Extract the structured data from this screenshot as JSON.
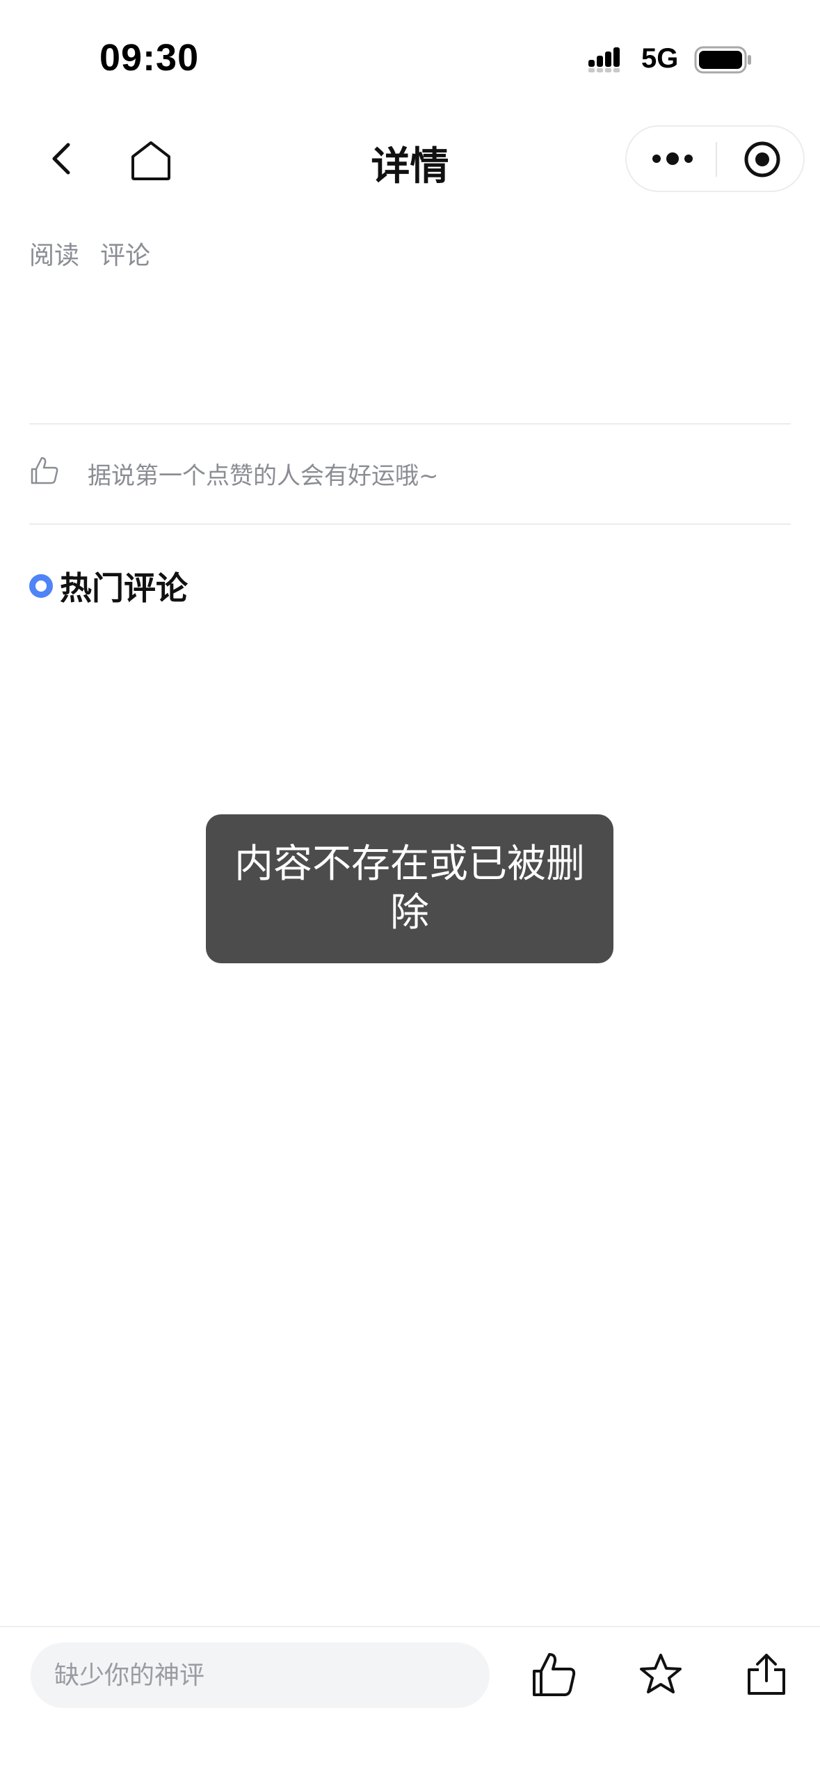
{
  "status_bar": {
    "time": "09:30",
    "network": "5G"
  },
  "nav": {
    "title": "详情",
    "icons": {
      "back": "chevron-left-icon",
      "home": "home-icon",
      "more": "more-dots-icon",
      "close": "target-circle-icon"
    }
  },
  "meta": {
    "read_label": "阅读",
    "comment_label": "评论"
  },
  "like_hint": "据说第一个点赞的人会有好运哦~",
  "hot_comments": {
    "title": "热门评论",
    "accent_color": "#4e84f6"
  },
  "toast": {
    "message": "内容不存在或已被删除"
  },
  "bottom_bar": {
    "input_placeholder": "缺少你的神评",
    "actions": [
      {
        "icon": "thumbs-up-icon"
      },
      {
        "icon": "star-icon"
      },
      {
        "icon": "share-icon"
      }
    ]
  }
}
